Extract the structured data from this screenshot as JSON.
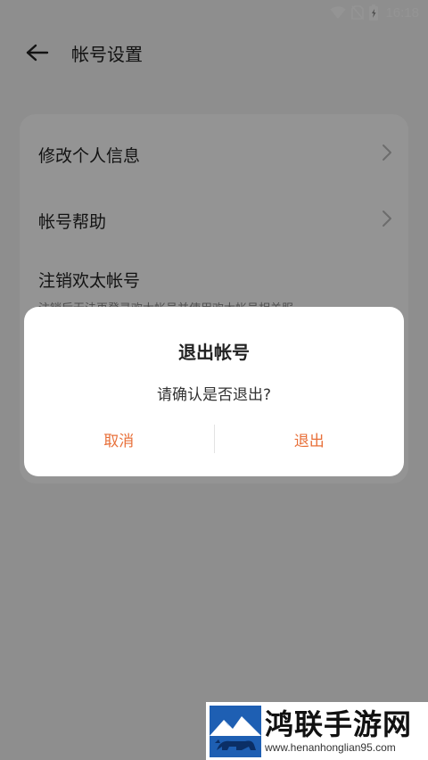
{
  "status_bar": {
    "time": "16:18",
    "icons": [
      "wifi-icon",
      "no-sim-icon",
      "battery-charging-icon"
    ]
  },
  "header": {
    "back_icon": "arrow-left-icon",
    "title": "帐号设置"
  },
  "settings": {
    "items": [
      {
        "label": "修改个人信息",
        "icon": "chevron-right-icon"
      },
      {
        "label": "帐号帮助",
        "icon": "chevron-right-icon"
      },
      {
        "label": "注销欢太帐号",
        "subtitle": "注销后无法再登录欢太帐号并使用欢太帐号相关服"
      }
    ]
  },
  "dialog": {
    "title": "退出帐号",
    "message": "请确认是否退出?",
    "cancel_label": "取消",
    "confirm_label": "退出"
  },
  "colors": {
    "accent": "#e8703a",
    "scrim": "rgba(0,0,0,0.42)",
    "card_bg": "#ffffff"
  },
  "watermark": {
    "name": "鸿联手游网",
    "url": "www.henanhonglian95.com",
    "logo_icon": "mountain-bull-logo-icon"
  }
}
